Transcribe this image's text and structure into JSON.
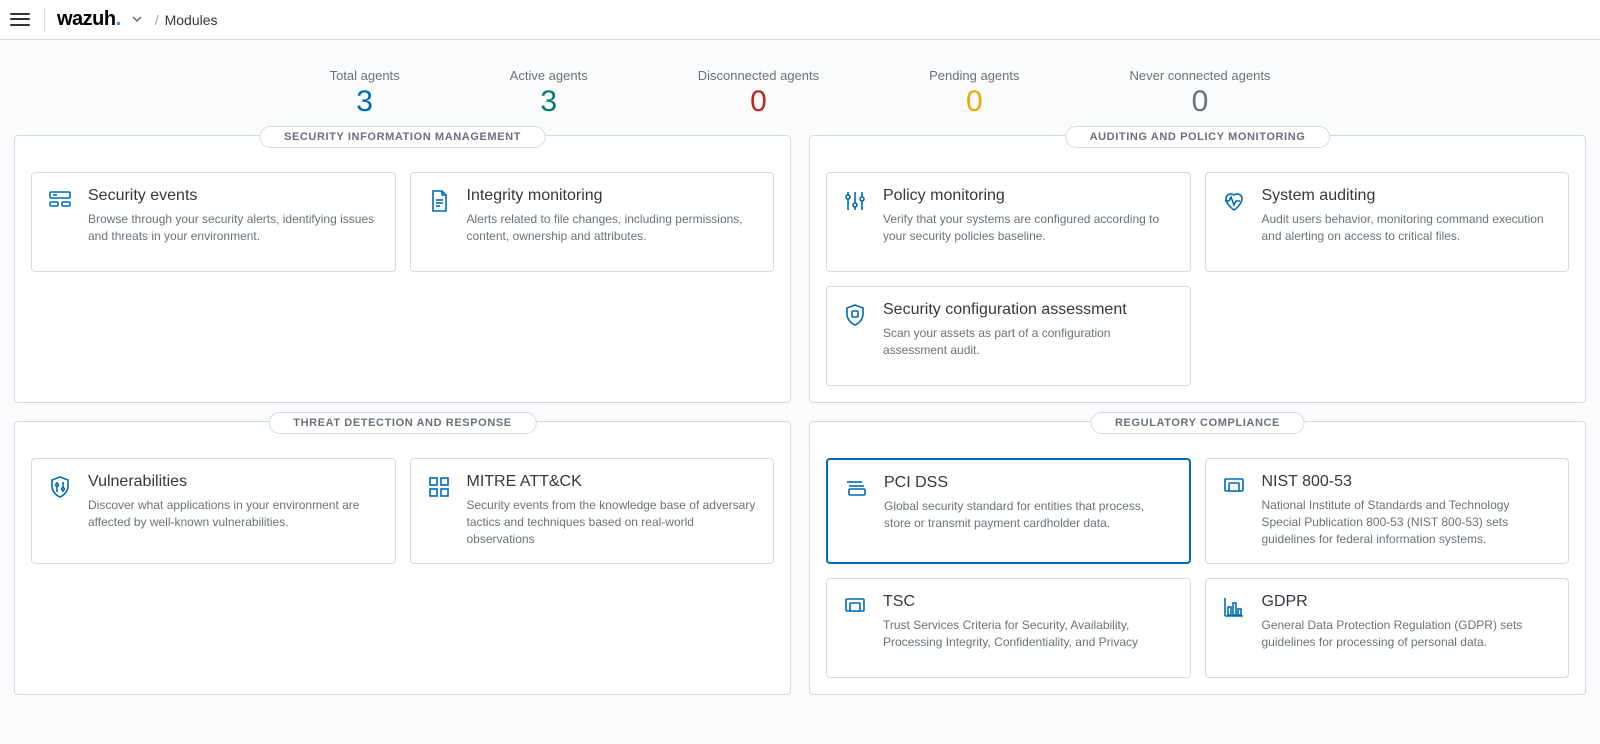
{
  "header": {
    "brand": "wazuh",
    "breadcrumb": "Modules"
  },
  "stats": [
    {
      "label": "Total agents",
      "value": "3",
      "color": "c-blue"
    },
    {
      "label": "Active agents",
      "value": "3",
      "color": "c-green"
    },
    {
      "label": "Disconnected agents",
      "value": "0",
      "color": "c-red"
    },
    {
      "label": "Pending agents",
      "value": "0",
      "color": "c-yellow"
    },
    {
      "label": "Never connected agents",
      "value": "0",
      "color": "c-grey"
    }
  ],
  "panels": {
    "sim": {
      "title": "SECURITY INFORMATION MANAGEMENT",
      "cards": {
        "security_events": {
          "title": "Security events",
          "desc": "Browse through your security alerts, identifying issues and threats in your environment."
        },
        "integrity_monitoring": {
          "title": "Integrity monitoring",
          "desc": "Alerts related to file changes, including permissions, content, ownership and attributes."
        }
      }
    },
    "apm": {
      "title": "AUDITING AND POLICY MONITORING",
      "cards": {
        "policy_monitoring": {
          "title": "Policy monitoring",
          "desc": "Verify that your systems are configured according to your security policies baseline."
        },
        "system_auditing": {
          "title": "System auditing",
          "desc": "Audit users behavior, monitoring command execution and alerting on access to critical files."
        },
        "sca": {
          "title": "Security configuration assessment",
          "desc": "Scan your assets as part of a configuration assessment audit."
        }
      }
    },
    "tdr": {
      "title": "THREAT DETECTION AND RESPONSE",
      "cards": {
        "vulnerabilities": {
          "title": "Vulnerabilities",
          "desc": "Discover what applications in your environment are affected by well-known vulnerabilities."
        },
        "mitre": {
          "title": "MITRE ATT&CK",
          "desc": "Security events from the knowledge base of adversary tactics and techniques based on real-world observations"
        }
      }
    },
    "rc": {
      "title": "REGULATORY COMPLIANCE",
      "cards": {
        "pci": {
          "title": "PCI DSS",
          "desc": "Global security standard for entities that process, store or transmit payment cardholder data."
        },
        "nist": {
          "title": "NIST 800-53",
          "desc": "National Institute of Standards and Technology Special Publication 800-53 (NIST 800-53) sets guidelines for federal information systems."
        },
        "tsc": {
          "title": "TSC",
          "desc": "Trust Services Criteria for Security, Availability, Processing Integrity, Confidentiality, and Privacy"
        },
        "gdpr": {
          "title": "GDPR",
          "desc": "General Data Protection Regulation (GDPR) sets guidelines for processing of personal data."
        }
      }
    }
  }
}
